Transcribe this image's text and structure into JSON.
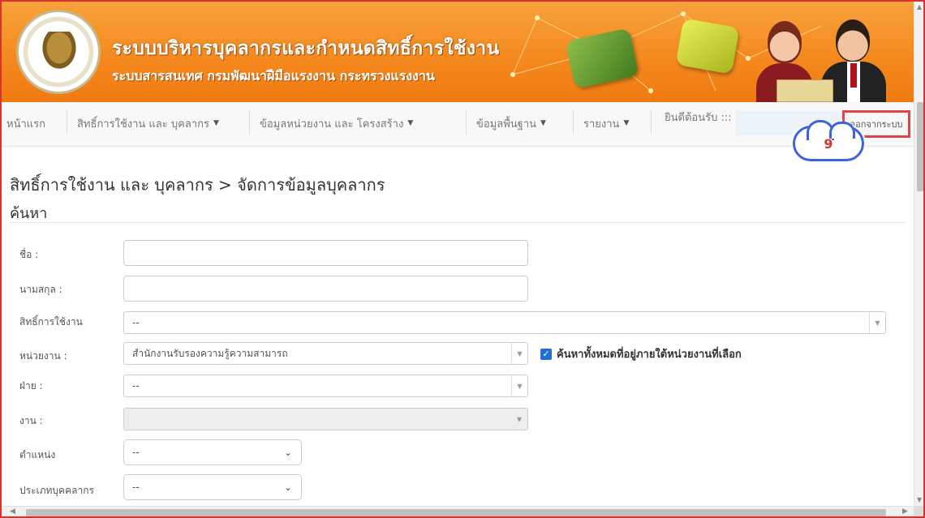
{
  "header": {
    "logo_text": "DEPARTMENT OF SKILL DEVELOPMENT",
    "title": "ระบบบริหารบุคลากรและกำหนดสิทธิ์การใช้งาน",
    "subtitle": "ระบบสารสนเทศ กรมพัฒนาฝีมือแรงงาน กระทรวงแรงงาน"
  },
  "nav": {
    "home": "หน้าแรก",
    "permissions": "สิทธิ์การใช้งาน และ บุคลากร",
    "units": "ข้อมูลหน่วยงาน และ โครงสร้าง",
    "basic": "ข้อมูลพื้นฐาน",
    "reports": "รายงาน",
    "welcome": "ยินดีต้อนรับ :::",
    "logout": "ออกจากระบบ",
    "caret": "▼"
  },
  "annotation": {
    "step": "9"
  },
  "page": {
    "breadcrumb": "สิทธิ์การใช้งาน และ บุคลากร > จัดการข้อมูลบุคลากร",
    "section": "ค้นหา"
  },
  "form": {
    "first_name_label": "ชื่อ :",
    "last_name_label": "นามสกุล :",
    "role_label": "สิทธิ์การใช้งาน",
    "role_value": "--",
    "unit_label": "หน่วยงาน :",
    "unit_value": "สำนักงานรับรองความรู้ความสามารถ",
    "include_sub_label": "ค้นหาทั้งหมดที่อยู่ภายใต้หน่วยงานที่เลือก",
    "division_label": "ฝ่าย :",
    "division_value": "--",
    "work_label": "งาน :",
    "work_value": "",
    "position_label": "ตำแหน่ง",
    "position_value": "--",
    "staff_type_label": "ประเภทบุคคลากร",
    "staff_type_value": "--"
  },
  "colors": {
    "header_orange": "#f58a1f",
    "highlight_red": "#e0454a",
    "cloud_blue": "#3d63e0",
    "checkbox_blue": "#1f6fd1"
  }
}
